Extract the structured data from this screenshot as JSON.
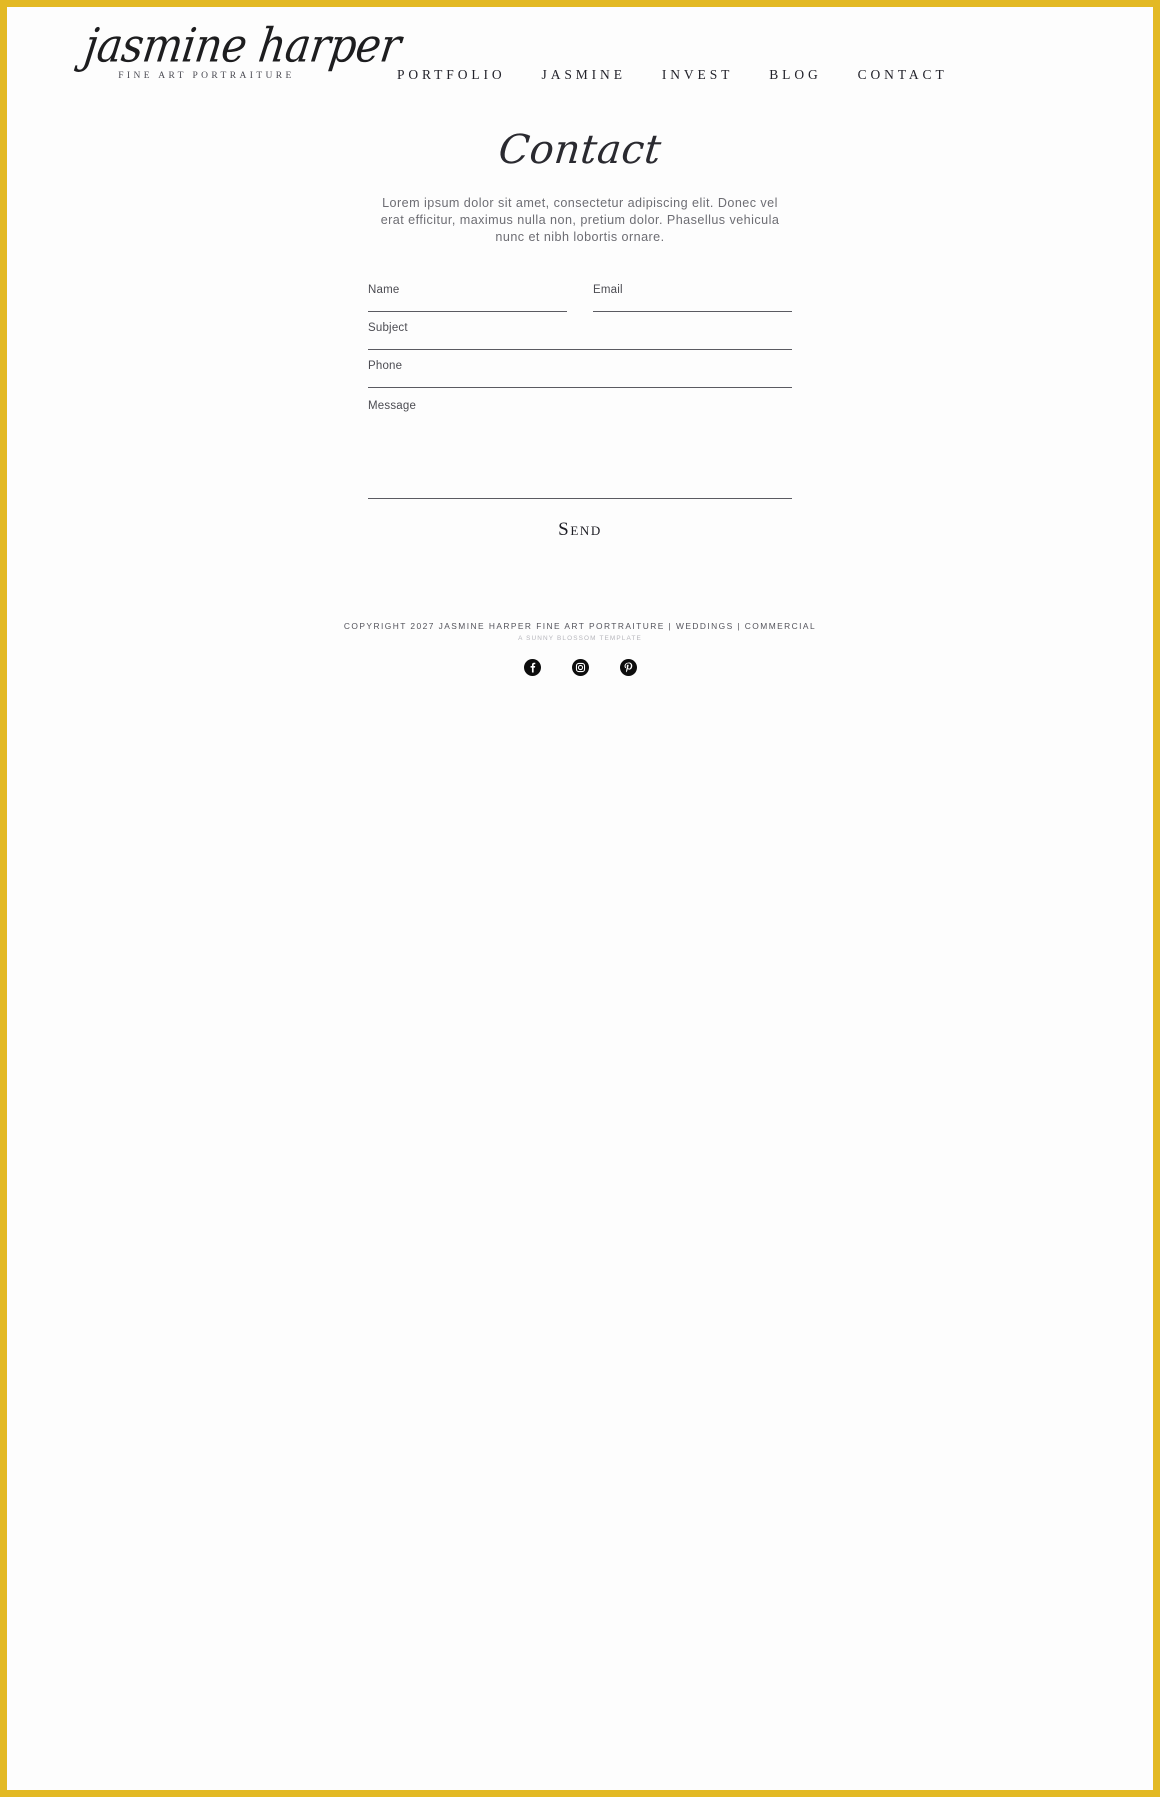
{
  "site": {
    "logo_script": "jasmine harper",
    "logo_subtitle": "FINE ART PORTRAITURE",
    "frame_color": "#e3b924",
    "background": "#fdfdfd"
  },
  "nav": {
    "items": [
      {
        "label": "PORTFOLIO"
      },
      {
        "label": "JASMINE"
      },
      {
        "label": "INVEST"
      },
      {
        "label": "BLOG"
      },
      {
        "label": "CONTACT"
      }
    ]
  },
  "main": {
    "title": "Contact",
    "intro": "Lorem ipsum dolor sit amet, consectetur adipiscing elit. Donec vel erat efficitur, maximus nulla non, pretium dolor. Phasellus vehicula nunc et nibh lobortis ornare."
  },
  "form": {
    "name": {
      "label": "Name",
      "value": "",
      "placeholder": ""
    },
    "email": {
      "label": "Email",
      "value": "",
      "placeholder": ""
    },
    "subject": {
      "label": "Subject",
      "value": "",
      "placeholder": ""
    },
    "phone": {
      "label": "Phone",
      "value": "",
      "placeholder": ""
    },
    "message": {
      "label": "Message",
      "value": "",
      "placeholder": ""
    },
    "submit_label": "Send"
  },
  "footer": {
    "copyright": "COPYRIGHT 2027 JASMINE HARPER FINE ART PORTRAITURE | WEDDINGS | COMMERCIAL",
    "credit": "A SUNNY BLOSSOM TEMPLATE",
    "social": [
      {
        "name": "facebook-icon"
      },
      {
        "name": "instagram-icon"
      },
      {
        "name": "pinterest-icon"
      }
    ]
  },
  "watermark": {
    "text": ""
  }
}
